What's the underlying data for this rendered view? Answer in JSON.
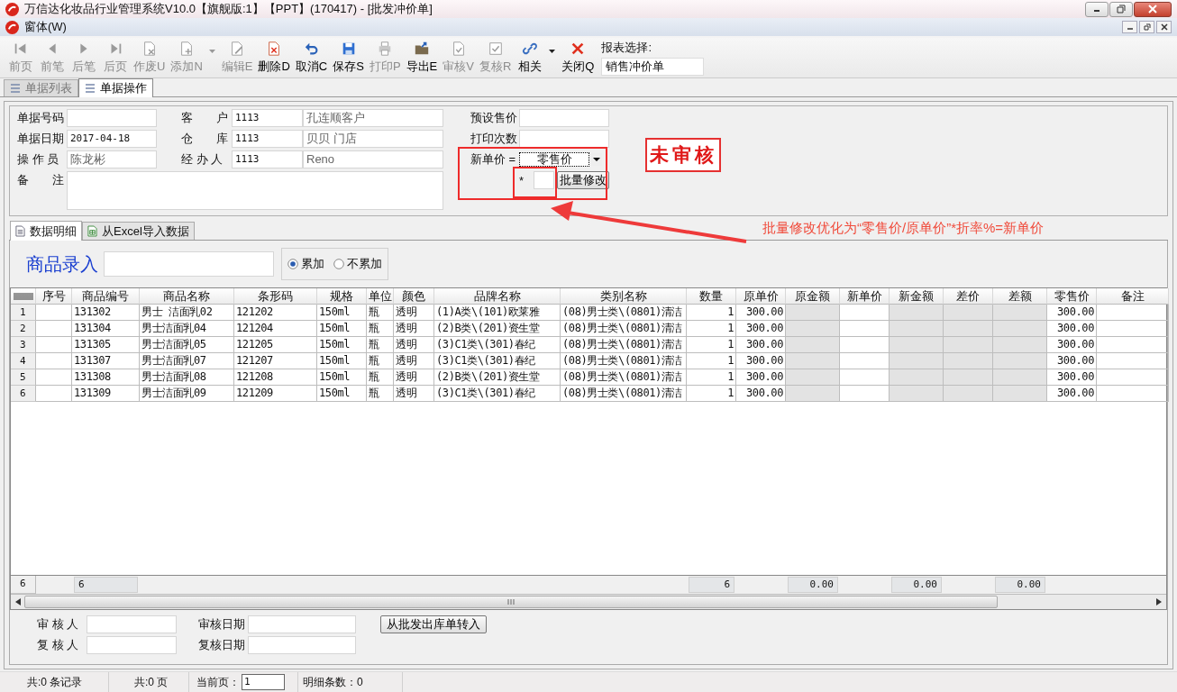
{
  "window": {
    "title": "万信达化妆品行业管理系统V10.0【旗舰版:1】【PPT】(170417) - [批发冲价单]"
  },
  "menu": [
    {
      "label": "窗体(W)"
    }
  ],
  "toolbar": [
    {
      "label": "前页",
      "disabled": true,
      "dropdown": false
    },
    {
      "label": "前笔",
      "disabled": true,
      "dropdown": false
    },
    {
      "label": "后笔",
      "disabled": true,
      "dropdown": false
    },
    {
      "label": "后页",
      "disabled": true,
      "dropdown": false
    },
    {
      "label": "作废U",
      "disabled": true,
      "dropdown": false
    },
    {
      "label": "添加N",
      "disabled": true,
      "dropdown": true
    },
    {
      "label": "编辑E",
      "disabled": true,
      "dropdown": false
    },
    {
      "label": "删除D",
      "disabled": false,
      "dropdown": false
    },
    {
      "label": "取消C",
      "disabled": false,
      "dropdown": false
    },
    {
      "label": "保存S",
      "disabled": false,
      "dropdown": false
    },
    {
      "label": "打印P",
      "disabled": true,
      "dropdown": false
    },
    {
      "label": "导出E",
      "disabled": false,
      "dropdown": false
    },
    {
      "label": "审核V",
      "disabled": true,
      "dropdown": false
    },
    {
      "label": "复核R",
      "disabled": true,
      "dropdown": false
    },
    {
      "label": "相关",
      "disabled": false,
      "dropdown": true
    },
    {
      "label": "关闭Q",
      "disabled": false,
      "dropdown": false
    }
  ],
  "report_select": {
    "label": "报表选择:",
    "value": "销售冲价单"
  },
  "tabs": [
    {
      "label": "单据列表",
      "selected": false
    },
    {
      "label": "单据操作",
      "selected": true
    }
  ],
  "form": {
    "left": [
      {
        "label": "单据号码"
      },
      {
        "label": "单据日期",
        "value": "2017-04-18",
        "readonly": false
      },
      {
        "label": "操 作 员",
        "value": "陈龙彬",
        "readonly": true
      }
    ],
    "middle": [
      {
        "label": "客　　户",
        "code": "1113",
        "name": "孔连顺客户"
      },
      {
        "label": "仓　　库",
        "code": "1113",
        "name": "贝贝 门店"
      },
      {
        "label": "经 办 人",
        "code": "1113",
        "name": "Reno"
      }
    ],
    "remark": {
      "label": "备　　注"
    },
    "right": [
      {
        "label": "预设售价"
      },
      {
        "label": "打印次数"
      }
    ],
    "new_price": {
      "label": "新单价 =",
      "select": "零售价",
      "multiplier": "*",
      "button": "批量修改"
    }
  },
  "stamp": "未审核",
  "annotation": "批量修改优化为“零售价/原单价”*折率%=新单价",
  "subtabs": [
    {
      "label": "数据明细",
      "selected": true
    },
    {
      "label": "从Excel导入数据",
      "selected": false
    }
  ],
  "entry": {
    "label": "商品录入",
    "options": [
      {
        "label": "累加",
        "selected": true
      },
      {
        "label": "不累加",
        "selected": false
      }
    ]
  },
  "grid": {
    "columns": [
      {
        "label": "序号",
        "readonly": false
      },
      {
        "label": "商品编号",
        "readonly": false
      },
      {
        "label": "商品名称",
        "readonly": false
      },
      {
        "label": "条形码",
        "readonly": false
      },
      {
        "label": "规格",
        "readonly": false
      },
      {
        "label": "单位",
        "readonly": false
      },
      {
        "label": "颜色",
        "readonly": false
      },
      {
        "label": "品牌名称",
        "readonly": false
      },
      {
        "label": "类别名称",
        "readonly": false
      },
      {
        "label": "数量",
        "readonly": false
      },
      {
        "label": "原单价",
        "readonly": false
      },
      {
        "label": "原金额",
        "readonly": true
      },
      {
        "label": "新单价",
        "readonly": false
      },
      {
        "label": "新金额",
        "readonly": true
      },
      {
        "label": "差价",
        "readonly": true
      },
      {
        "label": "差额",
        "readonly": true
      },
      {
        "label": "零售价",
        "readonly": false
      },
      {
        "label": "备注",
        "readonly": false
      }
    ],
    "rows": [
      {
        "number": "1",
        "product_code": "131302",
        "product_name": "男士 洁面乳02",
        "barcode": "121202",
        "spec": "150ml",
        "unit": "瓶",
        "color_label": "透明",
        "brand": "(1)A类\\(101)欧莱雅",
        "category": "(08)男士类\\(0801)清洁",
        "quantity": "1",
        "unit_price": "300.00",
        "retail_price": "300.00"
      },
      {
        "number": "2",
        "product_code": "131304",
        "product_name": "男士洁面乳04",
        "barcode": "121204",
        "spec": "150ml",
        "unit": "瓶",
        "color_label": "透明",
        "brand": "(2)B类\\(201)资生堂",
        "category": "(08)男士类\\(0801)清洁",
        "quantity": "1",
        "unit_price": "300.00",
        "retail_price": "300.00"
      },
      {
        "number": "3",
        "product_code": "131305",
        "product_name": "男士洁面乳05",
        "barcode": "121205",
        "spec": "150ml",
        "unit": "瓶",
        "color_label": "透明",
        "brand": "(3)C1类\\(301)春纪",
        "category": "(08)男士类\\(0801)清洁",
        "quantity": "1",
        "unit_price": "300.00",
        "retail_price": "300.00"
      },
      {
        "number": "4",
        "product_code": "131307",
        "product_name": "男士洁面乳07",
        "barcode": "121207",
        "spec": "150ml",
        "unit": "瓶",
        "color_label": "透明",
        "brand": "(3)C1类\\(301)春纪",
        "category": "(08)男士类\\(0801)清洁",
        "quantity": "1",
        "unit_price": "300.00",
        "retail_price": "300.00"
      },
      {
        "number": "5",
        "product_code": "131308",
        "product_name": "男士洁面乳08",
        "barcode": "121208",
        "spec": "150ml",
        "unit": "瓶",
        "color_label": "透明",
        "brand": "(2)B类\\(201)资生堂",
        "category": "(08)男士类\\(0801)清洁",
        "quantity": "1",
        "unit_price": "300.00",
        "retail_price": "300.00"
      },
      {
        "number": "6",
        "product_code": "131309",
        "product_name": "男士洁面乳09",
        "barcode": "121209",
        "spec": "150ml",
        "unit": "瓶",
        "color_label": "透明",
        "brand": "(3)C1类\\(301)春纪",
        "category": "(08)男士类\\(0801)清洁",
        "quantity": "1",
        "unit_price": "300.00",
        "retail_price": "300.00"
      }
    ],
    "footer": {
      "number": "6",
      "product_code": "6",
      "quantity": "6",
      "amount": "0.00",
      "new_amount": "0.00",
      "diff_amount": "0.00"
    }
  },
  "audit": {
    "fields": [
      {
        "label": "审 核 人"
      },
      {
        "label": "审核日期"
      },
      {
        "label": "复 核 人"
      },
      {
        "label": "复核日期"
      }
    ],
    "button": "从批发出库单转入"
  },
  "status_bar": {
    "records": "共:0 条记录",
    "pages": "共:0 页",
    "current_page_label": "当前页：",
    "current_page": "1",
    "detail_count": "明细条数：0"
  }
}
